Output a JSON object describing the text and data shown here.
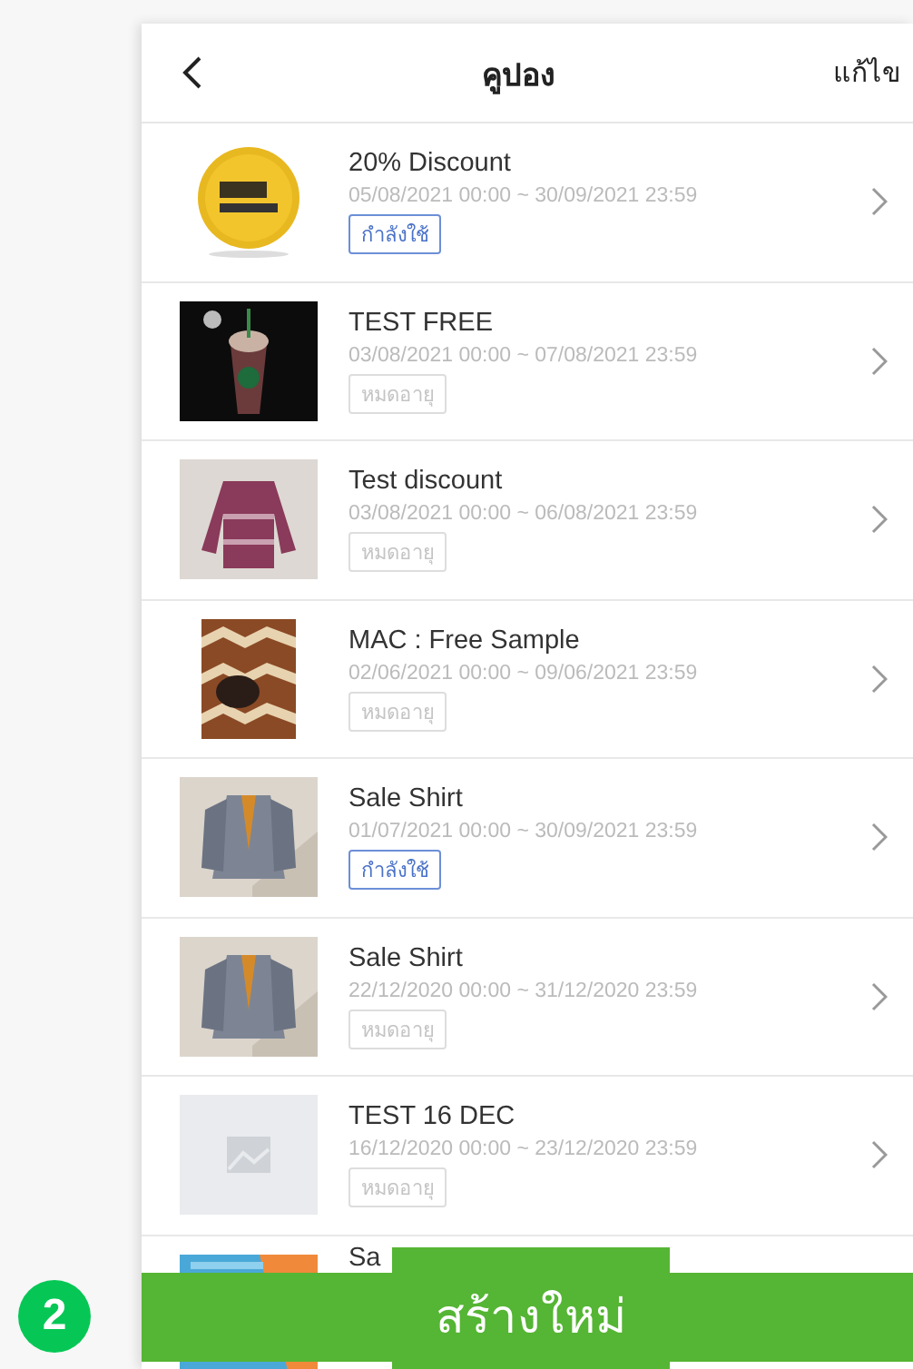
{
  "header": {
    "title": "คูปอง",
    "action": "แก้ไข"
  },
  "coupons": [
    {
      "title": "20% Discount",
      "period": "05/08/2021 00:00 ~ 30/09/2021 23:59",
      "status": "กำลังใช้",
      "active": true
    },
    {
      "title": "TEST FREE",
      "period": "03/08/2021 00:00 ~ 07/08/2021 23:59",
      "status": "หมดอายุ",
      "active": false
    },
    {
      "title": "Test discount",
      "period": "03/08/2021 00:00 ~ 06/08/2021 23:59",
      "status": "หมดอายุ",
      "active": false
    },
    {
      "title": "MAC : Free Sample",
      "period": "02/06/2021 00:00 ~ 09/06/2021 23:59",
      "status": "หมดอายุ",
      "active": false
    },
    {
      "title": "Sale Shirt",
      "period": "01/07/2021 00:00 ~ 30/09/2021 23:59",
      "status": "กำลังใช้",
      "active": true
    },
    {
      "title": "Sale Shirt",
      "period": "22/12/2020 00:00 ~ 31/12/2020 23:59",
      "status": "หมดอายุ",
      "active": false
    },
    {
      "title": "TEST 16 DEC",
      "period": "16/12/2020 00:00 ~ 23/12/2020 23:59",
      "status": "หมดอายุ",
      "active": false,
      "image": {
        "kind": "placeholder"
      }
    }
  ],
  "partial_coupon": {
    "title": "Sa"
  },
  "create_button": "สร้างใหม่",
  "step_badge": "2"
}
